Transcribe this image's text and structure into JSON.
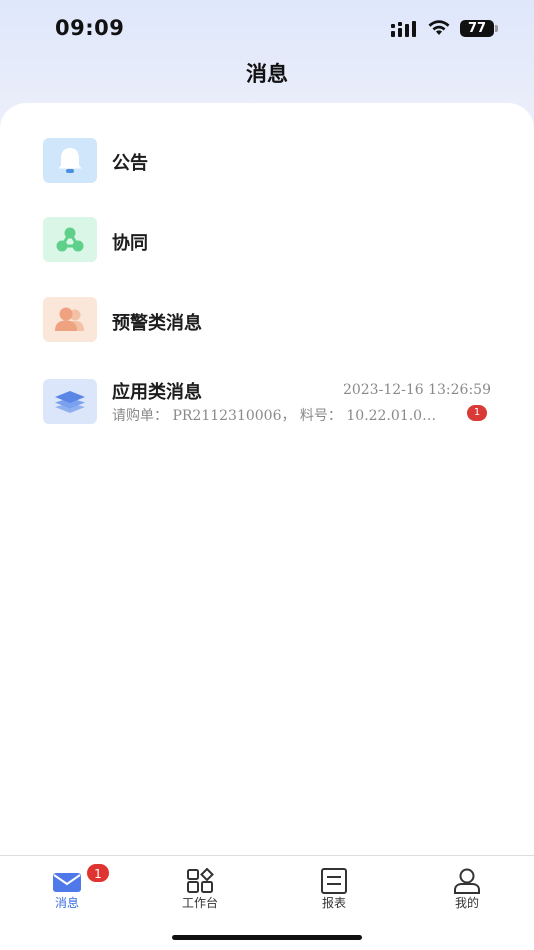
{
  "status_bar": {
    "time": "09:09",
    "battery": "77"
  },
  "header": {
    "title": "消息"
  },
  "messages": [
    {
      "title": "公告",
      "icon": "bell-icon",
      "color": "#cfe6fb"
    },
    {
      "title": "协同",
      "icon": "collaboration-icon",
      "color": "#d9f6e6"
    },
    {
      "title": "预警类消息",
      "icon": "users-icon",
      "color": "#fbe6da"
    },
    {
      "title": "应用类消息",
      "icon": "layers-icon",
      "color": "#dbe6fb",
      "time": "2023-12-16 13:26:59",
      "preview": "请购单：  PR2112310006，  料号：  10.22.01.0…",
      "badge": "1"
    }
  ],
  "tabbar": {
    "tabs": [
      {
        "label": "消息",
        "icon": "mail-icon",
        "active": true,
        "badge": "1"
      },
      {
        "label": "工作台",
        "icon": "grid-icon",
        "active": false
      },
      {
        "label": "报表",
        "icon": "report-icon",
        "active": false
      },
      {
        "label": "我的",
        "icon": "profile-icon",
        "active": false
      }
    ]
  },
  "colors": {
    "accent": "#3a6fe0",
    "badge": "#e03431"
  }
}
